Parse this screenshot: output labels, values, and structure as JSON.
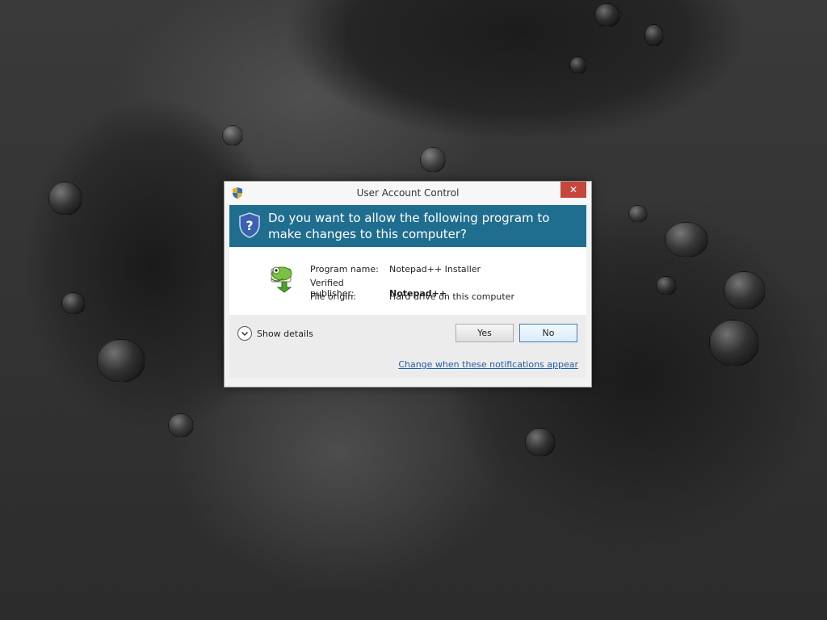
{
  "dialog": {
    "title": "User Account Control",
    "close_glyph": "✕",
    "question": "Do you want to allow the following program to make changes to this computer?",
    "program_name_label": "Program name:",
    "program_name_value": "Notepad++ Installer",
    "publisher_label": "Verified publisher:",
    "publisher_value": "Notepad++",
    "origin_label": "File origin:",
    "origin_value": "Hard drive on this computer",
    "show_details_label": "Show details",
    "yes_label": "Yes",
    "no_label": "No",
    "change_link": "Change when these notifications appear"
  },
  "icons": {
    "title": "uac-shield-icon",
    "header": "uac-shield-icon",
    "program": "notepad-plus-plus-chameleon-icon",
    "details": "chevron-down-icon",
    "close": "close-icon"
  },
  "colors": {
    "header_bg": "#1f6e8f",
    "close_bg": "#c7463c",
    "link": "#1f5fb0"
  }
}
